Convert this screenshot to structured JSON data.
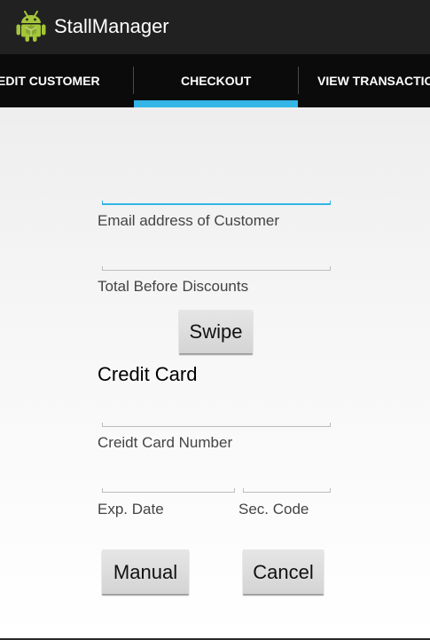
{
  "app": {
    "title": "StallManager",
    "icon": "android-robot-icon",
    "brand_color": "#a4c639"
  },
  "tabs": [
    {
      "label": "EDIT CUSTOMER",
      "selected": false
    },
    {
      "label": "CHECKOUT",
      "selected": true
    },
    {
      "label": "VIEW TRANSACTIO",
      "selected": false
    }
  ],
  "colors": {
    "accent": "#33b5e5",
    "action_bar": "#212121",
    "tab_bar": "#0b0b0b"
  },
  "form": {
    "email": {
      "label": "Email address of Customer",
      "value": "",
      "focused": true
    },
    "total": {
      "label": "Total Before Discounts",
      "value": ""
    },
    "swipe_button": "Swipe",
    "credit_card_heading": "Credit Card",
    "card_number": {
      "label": "Creidt Card Number",
      "value": ""
    },
    "exp_date": {
      "label": "Exp. Date",
      "value": ""
    },
    "sec_code": {
      "label": "Sec. Code",
      "value": ""
    },
    "manual_button": "Manual",
    "cancel_button": "Cancel"
  }
}
